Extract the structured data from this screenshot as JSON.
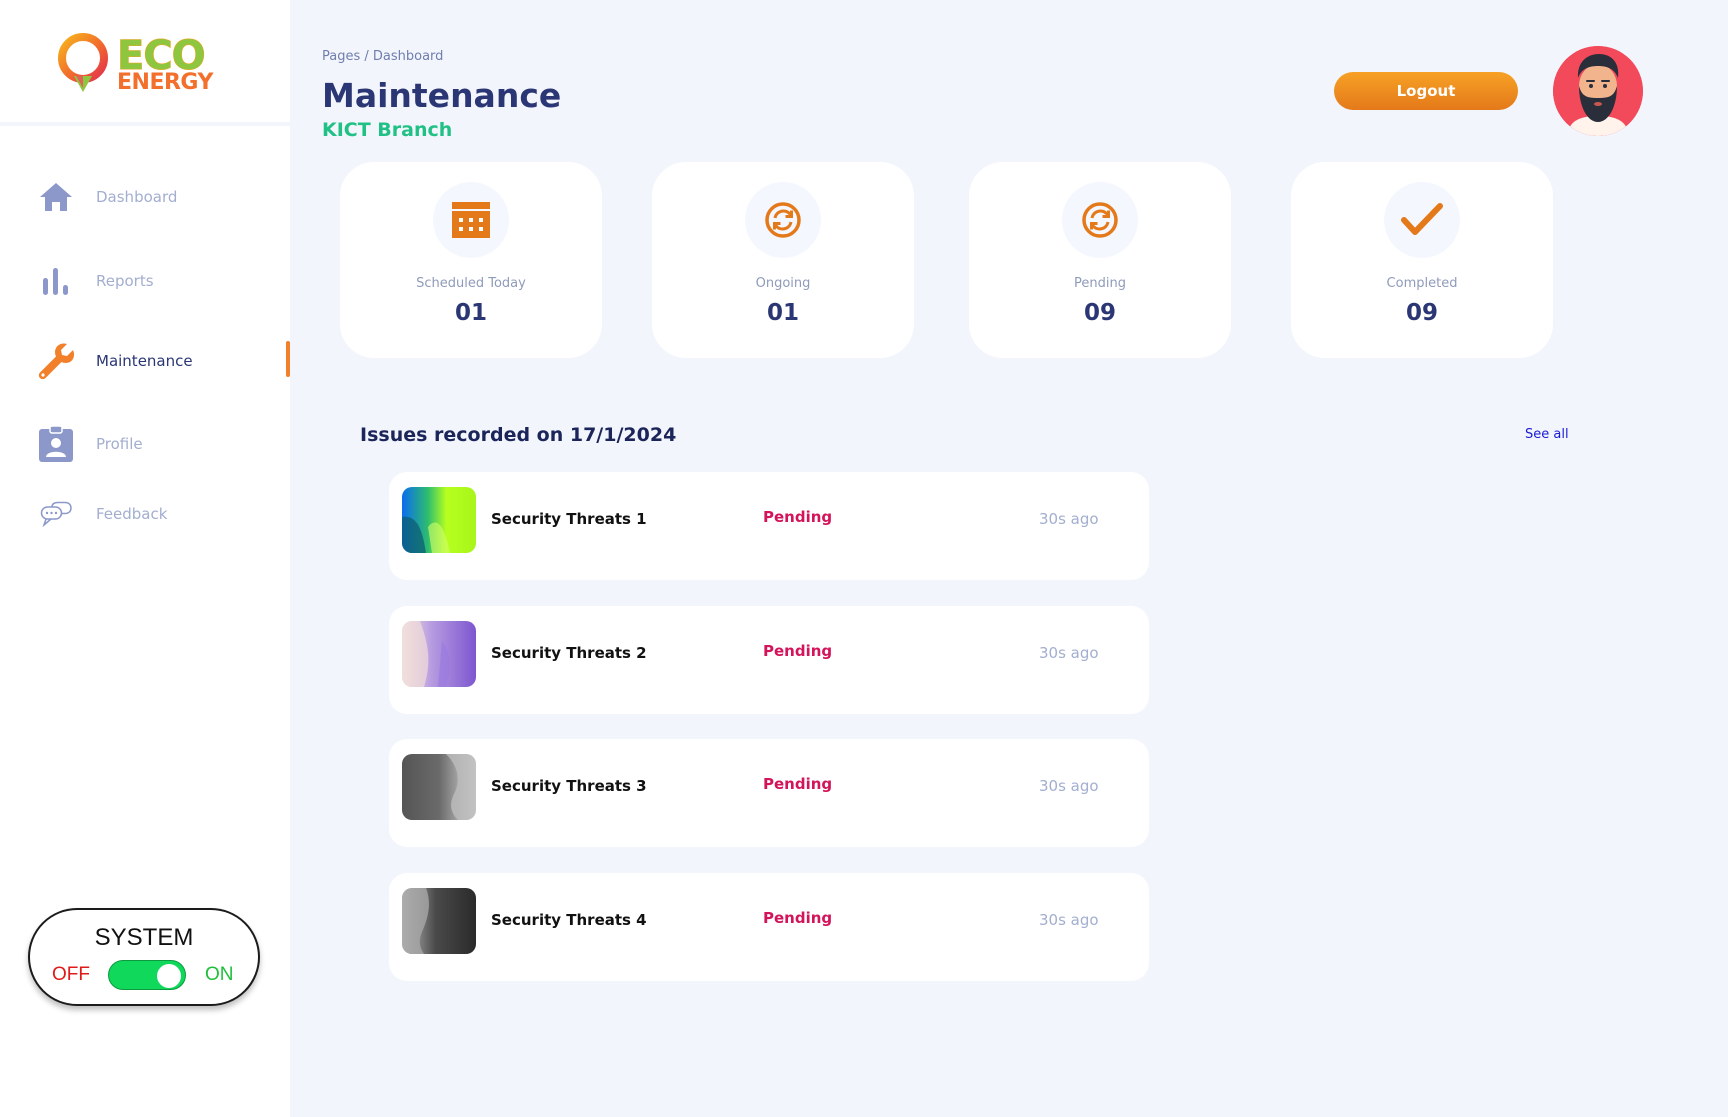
{
  "brand": {
    "line1": "ECO",
    "line2": "ENERGY"
  },
  "sidebar": {
    "items": [
      {
        "label": "Dashboard",
        "icon": "home-icon"
      },
      {
        "label": "Reports",
        "icon": "bar-chart-icon"
      },
      {
        "label": "Maintenance",
        "icon": "wrench-icon",
        "active": true
      },
      {
        "label": "Profile",
        "icon": "id-badge-icon"
      },
      {
        "label": "Feedback",
        "icon": "chat-icon"
      }
    ]
  },
  "system": {
    "title": "SYSTEM",
    "off_label": "OFF",
    "on_label": "ON",
    "state": "on"
  },
  "header": {
    "breadcrumb": "Pages / Dashboard",
    "title": "Maintenance",
    "branch": "KICT Branch",
    "logout_label": "Logout"
  },
  "stats": [
    {
      "label": "Scheduled Today",
      "value": "01",
      "icon": "calendar-icon"
    },
    {
      "label": "Ongoing",
      "value": "01",
      "icon": "refresh-icon"
    },
    {
      "label": "Pending",
      "value": "09",
      "icon": "refresh-icon"
    },
    {
      "label": "Completed",
      "value": "09",
      "icon": "checkmark-icon"
    }
  ],
  "issues": {
    "title": "Issues recorded on 17/1/2024",
    "see_all": "See all",
    "rows": [
      {
        "title": "Security Threats 1",
        "status": "Pending",
        "time": "30s ago"
      },
      {
        "title": "Security Threats 2",
        "status": "Pending",
        "time": "30s ago"
      },
      {
        "title": "Security Threats 3",
        "status": "Pending",
        "time": "30s ago"
      },
      {
        "title": "Security Threats 4",
        "status": "Pending",
        "time": "30s ago"
      }
    ]
  },
  "colors": {
    "accent": "#f2802b",
    "primary_text": "#2b3674",
    "branch": "#21c186",
    "pending": "#d4145a",
    "toggle_on": "#0fd85a"
  }
}
